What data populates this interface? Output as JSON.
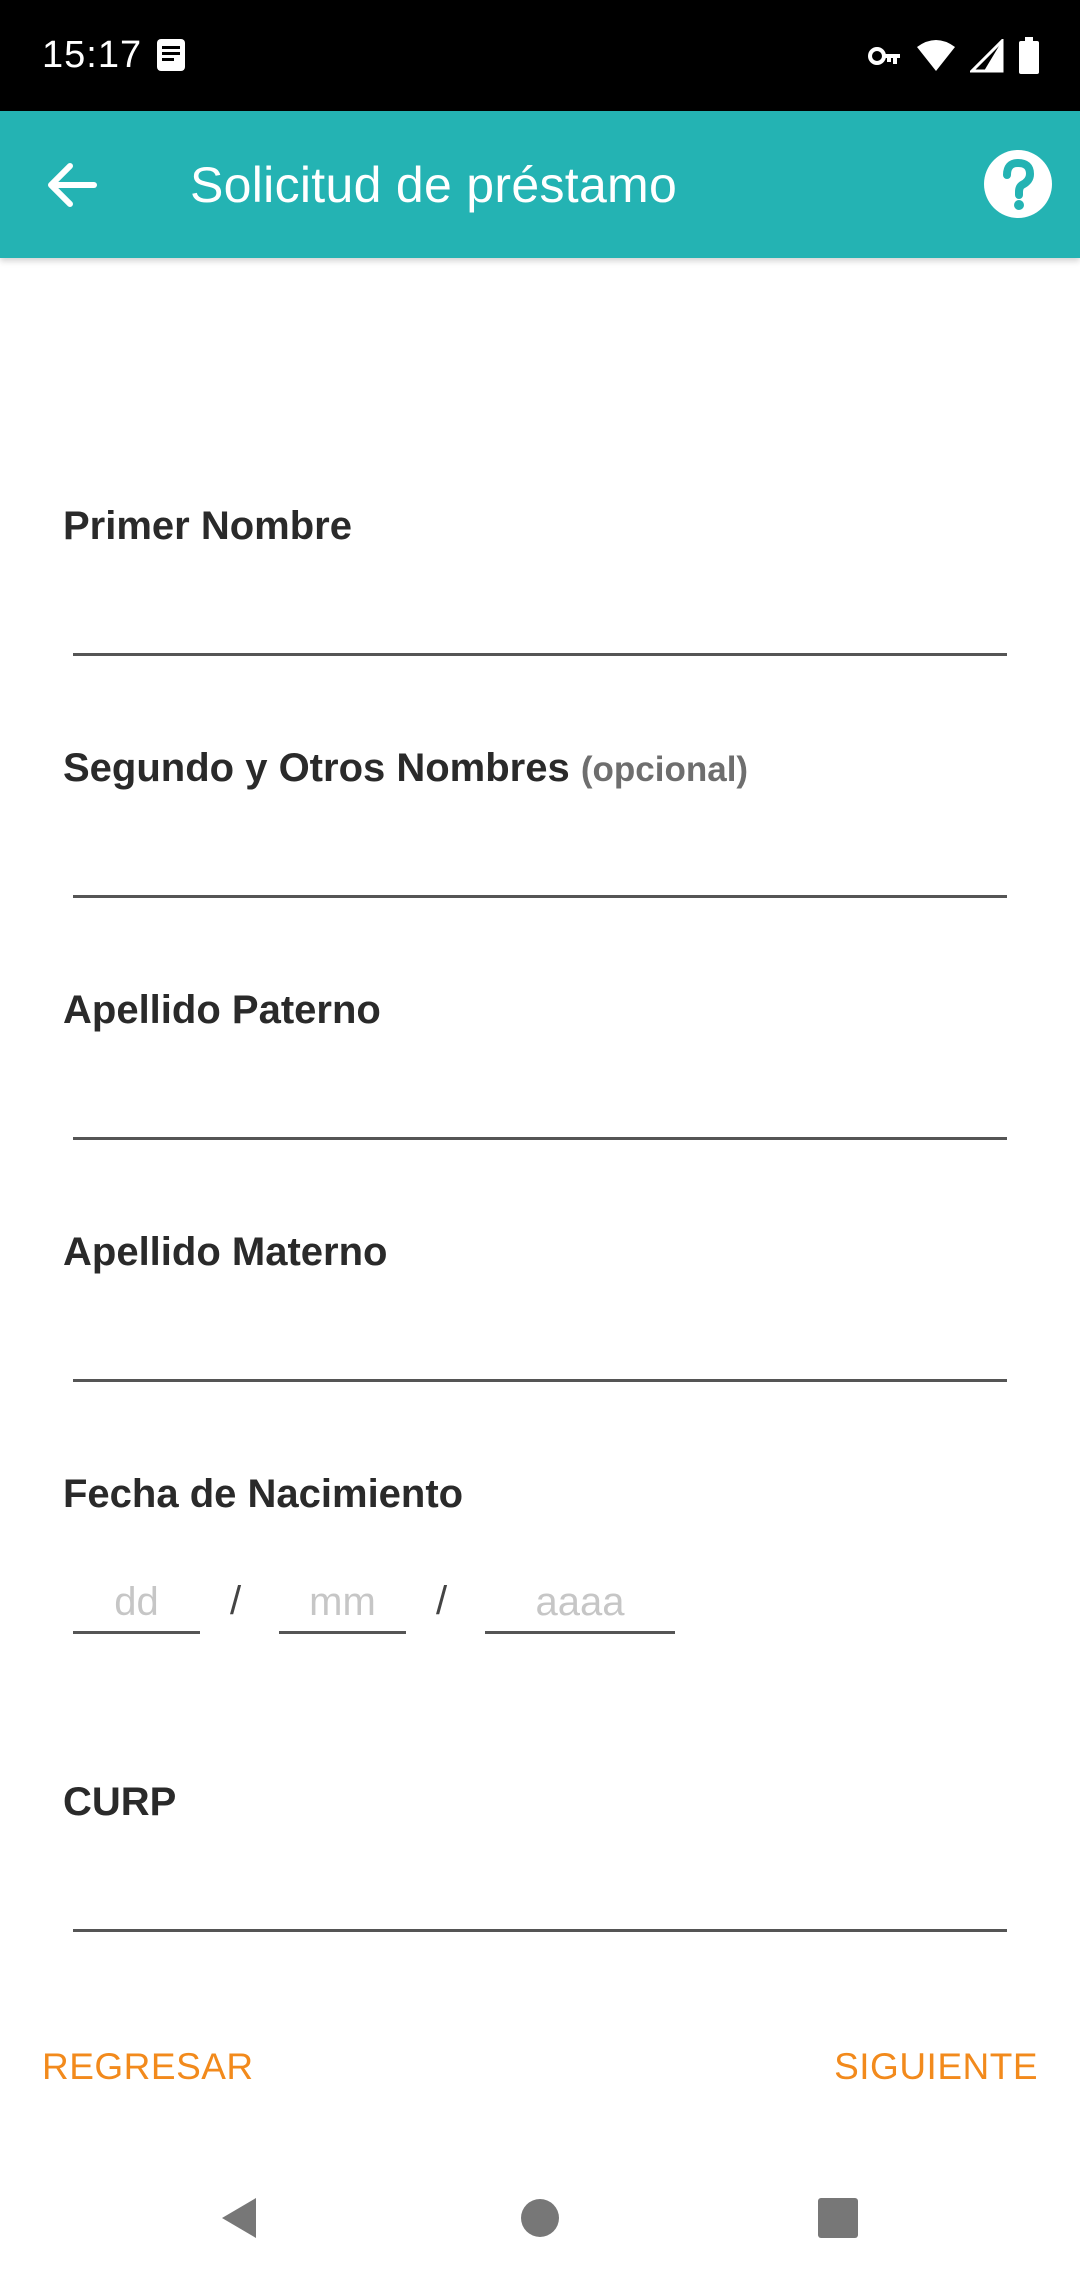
{
  "status_bar": {
    "time": "15:17",
    "icons": [
      "notification-doc-icon",
      "vpn-key-icon",
      "wifi-icon",
      "signal-icon",
      "battery-icon"
    ]
  },
  "app_bar": {
    "title": "Solicitud de préstamo",
    "background_color": "#24b3b3",
    "back_icon": "arrow-back-icon",
    "help_icon": "help-circle-icon"
  },
  "form": {
    "first_name": {
      "label": "Primer Nombre",
      "value": ""
    },
    "middle_names": {
      "label": "Segundo y Otros Nombres",
      "optional_label": "(opcional)",
      "value": ""
    },
    "paternal_surname": {
      "label": "Apellido Paterno",
      "value": ""
    },
    "maternal_surname": {
      "label": "Apellido Materno",
      "value": ""
    },
    "birth_date": {
      "label": "Fecha de Nacimiento",
      "day_placeholder": "dd",
      "month_placeholder": "mm",
      "year_placeholder": "aaaa",
      "separator": "/"
    },
    "curp": {
      "label": "CURP",
      "value": ""
    }
  },
  "footer": {
    "back_label": "REGRESAR",
    "next_label": "SIGUIENTE",
    "accent_color": "#f28a1c"
  },
  "nav_bar": {
    "icons": [
      "nav-back-icon",
      "nav-home-icon",
      "nav-recents-icon"
    ]
  }
}
